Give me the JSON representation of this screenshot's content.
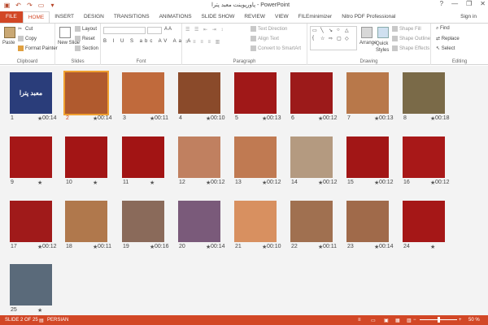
{
  "app": {
    "title": "پاورپوینت معبد پترا - PowerPoint",
    "sign_in": "Sign in",
    "window_controls": [
      "?",
      "—",
      "❐",
      "✕"
    ]
  },
  "tabs": [
    "FILE",
    "HOME",
    "INSERT",
    "DESIGN",
    "TRANSITIONS",
    "ANIMATIONS",
    "SLIDE SHOW",
    "REVIEW",
    "VIEW",
    "FILEminimizer",
    "Nitro PDF Professional"
  ],
  "ribbon": {
    "clipboard": {
      "label": "Clipboard",
      "paste": "Paste",
      "cut": "Cut",
      "copy": "Copy",
      "format_painter": "Format Painter"
    },
    "slides": {
      "label": "Slides",
      "new_slide": "New Slide",
      "layout": "Layout",
      "reset": "Reset",
      "section": "Section"
    },
    "font": {
      "label": "Font"
    },
    "paragraph": {
      "label": "Paragraph",
      "text_direction": "Text Direction",
      "align_text": "Align Text",
      "convert_smartart": "Convert to SmartArt"
    },
    "drawing": {
      "label": "Drawing",
      "arrange": "Arrange",
      "quick_styles": "Quick Styles",
      "shape_fill": "Shape Fill",
      "shape_outline": "Shape Outline",
      "shape_effects": "Shape Effects"
    },
    "editing": {
      "label": "Editing",
      "find": "Find",
      "replace": "Replace",
      "select": "Select"
    }
  },
  "slides": [
    {
      "num": "1",
      "dur": "00:14",
      "color": "#2a3d7a",
      "text": "معبد پترا"
    },
    {
      "num": "2",
      "dur": "00:14",
      "color": "#b05a2e",
      "text": ""
    },
    {
      "num": "3",
      "dur": "00:11",
      "color": "#c06a3c",
      "text": ""
    },
    {
      "num": "4",
      "dur": "00:10",
      "color": "#8a4a2a",
      "text": ""
    },
    {
      "num": "5",
      "dur": "00:13",
      "color": "#a01818",
      "text": ""
    },
    {
      "num": "6",
      "dur": "00:12",
      "color": "#9c1a1a",
      "text": ""
    },
    {
      "num": "7",
      "dur": "00:13",
      "color": "#b8784a",
      "text": ""
    },
    {
      "num": "8",
      "dur": "00:18",
      "color": "#7a6a48",
      "text": ""
    },
    {
      "num": "9",
      "dur": "",
      "color": "#a51717",
      "text": ""
    },
    {
      "num": "10",
      "dur": "",
      "color": "#a31515",
      "text": ""
    },
    {
      "num": "11",
      "dur": "",
      "color": "#a21414",
      "text": ""
    },
    {
      "num": "12",
      "dur": "00:12",
      "color": "#c08060",
      "text": ""
    },
    {
      "num": "13",
      "dur": "00:12",
      "color": "#c07a52",
      "text": ""
    },
    {
      "num": "14",
      "dur": "00:12",
      "color": "#b49a80",
      "text": ""
    },
    {
      "num": "15",
      "dur": "00:12",
      "color": "#a21616",
      "text": ""
    },
    {
      "num": "16",
      "dur": "00:12",
      "color": "#a81818",
      "text": ""
    },
    {
      "num": "17",
      "dur": "00:12",
      "color": "#a01a1a",
      "text": ""
    },
    {
      "num": "18",
      "dur": "00:11",
      "color": "#b0784c",
      "text": ""
    },
    {
      "num": "19",
      "dur": "00:16",
      "color": "#8a6a5a",
      "text": ""
    },
    {
      "num": "20",
      "dur": "00:14",
      "color": "#7a5a7a",
      "text": ""
    },
    {
      "num": "21",
      "dur": "00:10",
      "color": "#d89060",
      "text": ""
    },
    {
      "num": "22",
      "dur": "00:11",
      "color": "#a07050",
      "text": ""
    },
    {
      "num": "23",
      "dur": "00:14",
      "color": "#a06a4a",
      "text": ""
    },
    {
      "num": "24",
      "dur": "",
      "color": "#a51717",
      "text": ""
    },
    {
      "num": "25",
      "dur": "",
      "color": "#5a6a7a",
      "text": ""
    }
  ],
  "statusbar": {
    "slide_info": "SLIDE 2 OF 25",
    "language": "PERSIAN",
    "zoom": "50 %",
    "zoom_level": 0.5
  }
}
